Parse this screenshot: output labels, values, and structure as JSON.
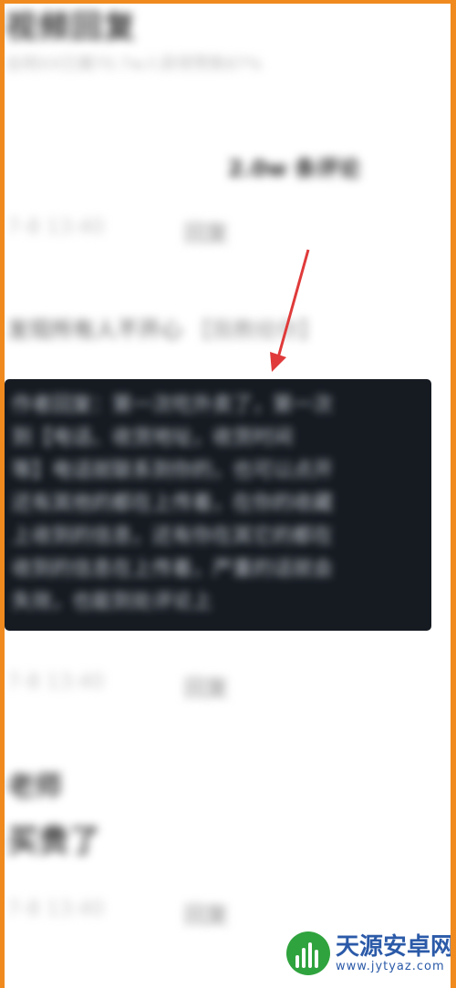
{
  "header": {
    "title": "视频回复",
    "subtitle": "全网XX已播70.7w人获得赞数87%"
  },
  "comments_count": "2.0w 条评论",
  "comment_1": {
    "time": "7-8 13:40",
    "reply": "回复",
    "text": "发现所有人不开心",
    "bracket": "【我教给你】"
  },
  "highlighted_text": [
    "作者回复：第一次吃外卖了，第一次",
    "到【电话、收货地址，收货时间",
    "等】电话就联系到你的，也可以点开",
    "还有其他的都在上传着，在你的收藏",
    "上收到的信息，还有你在其它的都在",
    "收到的信息在上传着，严重的话就会",
    "失效，也能到处评论上"
  ],
  "row_after_highlight": {
    "time": "7-8 13:40",
    "reply": "回复"
  },
  "comment_2": {
    "author": "老师",
    "text": "买贵了",
    "time": "7-8 13:40",
    "reply": "回复"
  },
  "watermark": {
    "name": "天源安卓网",
    "url": "www.jytyaz.com"
  },
  "colors": {
    "frame": "#f08a1e",
    "highlight_bg": "#161b22",
    "arrow": "#e03a3a",
    "watermark": "#2b5aa8"
  }
}
